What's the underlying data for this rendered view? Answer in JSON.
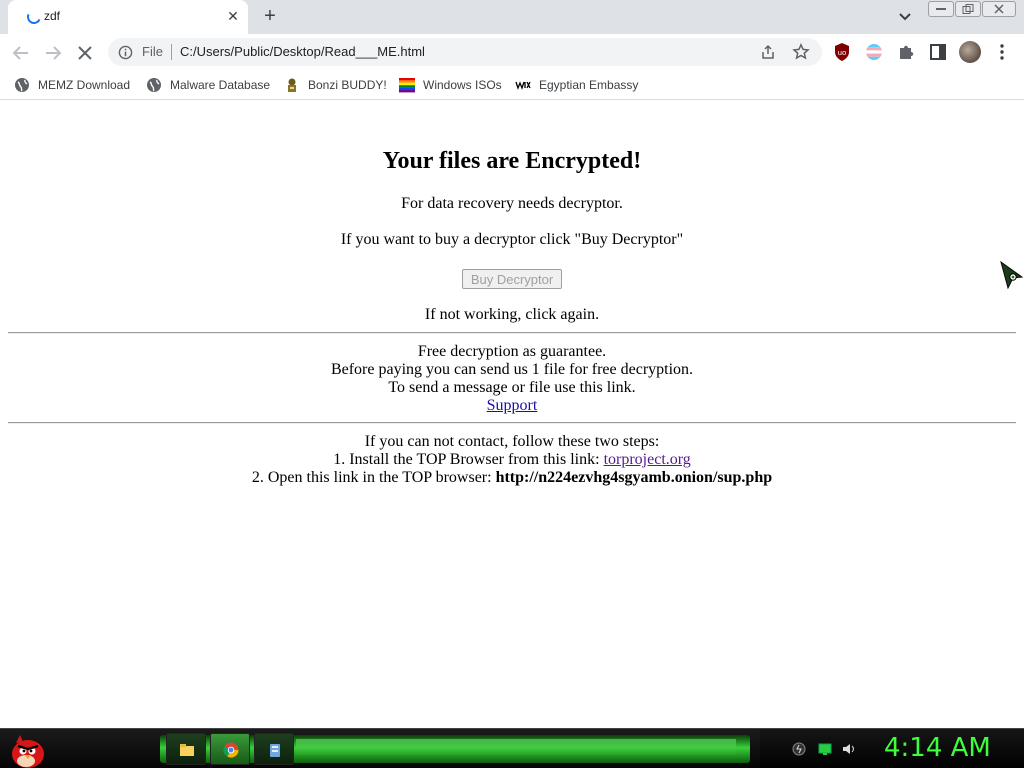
{
  "browser": {
    "tab": {
      "title": "zdf",
      "close_glyph": "✕"
    },
    "new_tab_glyph": "+",
    "address": {
      "scheme_label": "File",
      "url": "C:/Users/Public/Desktop/Read___ME.html"
    },
    "bookmarks": [
      {
        "label": "MEMZ Download",
        "icon": "globe-icon"
      },
      {
        "label": "Malware Database",
        "icon": "globe-icon"
      },
      {
        "label": "Bonzi BUDDY!",
        "icon": "bonzi-icon"
      },
      {
        "label": "Windows ISOs",
        "icon": "rainbow-flag-icon"
      },
      {
        "label": "Egyptian Embassy",
        "icon": "wix-icon"
      }
    ]
  },
  "page": {
    "title": "Your files are Encrypted!",
    "recovery_line": "For data recovery needs decryptor.",
    "buy_line": "If you want to buy a decryptor click \"Buy Decryptor\"",
    "buy_button": "Buy Decryptor",
    "retry_line": "If not working, click again.",
    "free": {
      "line1": "Free decryption as guarantee.",
      "line2": "Before paying you can send us 1 file for free decryption.",
      "line3": "To send a message or file use this link.",
      "support_link": "Support"
    },
    "steps": {
      "intro": "If you can not contact, follow these two steps:",
      "step1_text": "1. Install the TOP Browser from this link:",
      "step1_link": "torproject.org",
      "step2_text": "2. Open this link in the TOP browser:",
      "step2_url": "http://n224ezvhg4sgyamb.onion/sup.php"
    }
  },
  "taskbar": {
    "clock": "4:14 AM",
    "items": [
      "file-explorer-icon",
      "chrome-icon",
      "app-icon"
    ],
    "accent_color": "#38d038"
  }
}
